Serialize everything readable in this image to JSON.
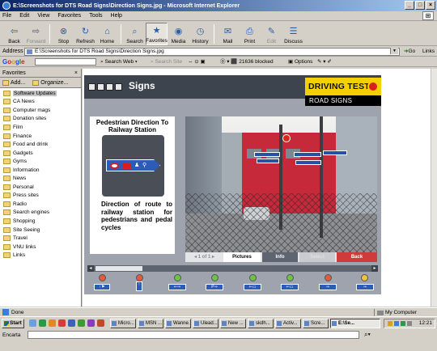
{
  "window": {
    "title": "E:\\Screenshots for DTS Road Signs\\Direction Signs.jpg - Microsoft Internet Explorer",
    "min": "_",
    "max": "□",
    "close": "×"
  },
  "menu": [
    "File",
    "Edit",
    "View",
    "Favorites",
    "Tools",
    "Help"
  ],
  "toolbar": [
    {
      "label": "Back",
      "icon": "back-arrow-icon",
      "glyph": "⇦",
      "disabled": false
    },
    {
      "label": "Forward",
      "icon": "forward-arrow-icon",
      "glyph": "⇨",
      "disabled": true
    },
    {
      "label": "Stop",
      "icon": "stop-icon",
      "glyph": "⊗",
      "disabled": false
    },
    {
      "label": "Refresh",
      "icon": "refresh-icon",
      "glyph": "↻",
      "disabled": false
    },
    {
      "label": "Home",
      "icon": "home-icon",
      "glyph": "⌂",
      "disabled": false
    },
    {
      "label": "Search",
      "icon": "search-icon",
      "glyph": "⌕",
      "disabled": false
    },
    {
      "label": "Favorites",
      "icon": "favorites-icon",
      "glyph": "★",
      "disabled": false,
      "active": true
    },
    {
      "label": "Media",
      "icon": "media-icon",
      "glyph": "◉",
      "disabled": false
    },
    {
      "label": "History",
      "icon": "history-icon",
      "glyph": "◷",
      "disabled": false
    },
    {
      "label": "Mail",
      "icon": "mail-icon",
      "glyph": "✉",
      "disabled": false
    },
    {
      "label": "Print",
      "icon": "print-icon",
      "glyph": "⎙",
      "disabled": false
    },
    {
      "label": "Edit",
      "icon": "edit-icon",
      "glyph": "✎",
      "disabled": true
    },
    {
      "label": "Discuss",
      "icon": "discuss-icon",
      "glyph": "☰",
      "disabled": false
    }
  ],
  "address": {
    "label": "Address",
    "value": "E:\\Screenshots for DTS Road Signs\\Direction Signs.jpg",
    "go": "Go",
    "links": "Links"
  },
  "google": {
    "logo": [
      "G",
      "o",
      "o",
      "g",
      "l",
      "e"
    ],
    "search_web": "Search Web",
    "search_site": "Search Site",
    "blocked": "21636 blocked",
    "options": "Options"
  },
  "sidebar": {
    "title": "Favorites",
    "close": "×",
    "add": "Add...",
    "organize": "Organize...",
    "items": [
      "Software Updates",
      "CA News",
      "Computer mags",
      "Donation sites",
      "Film",
      "Finance",
      "Food and drink",
      "Gadgets",
      "Gyms",
      "Information",
      "News",
      "Personal",
      "Press sites",
      "Radio",
      "Search engines",
      "Shopping",
      "Site Seeing",
      "Travel",
      "VNU links",
      "Links"
    ]
  },
  "app": {
    "title": "Signs",
    "brand_top": "DRIVING TEST",
    "brand_bottom": "ROAD SIGNS",
    "card_title": "Pedestrian Direction To Railway Station",
    "card_desc": "Direction of route to railway station for pedestrians and pedal cycles",
    "pager": "1 of 1",
    "tabs": {
      "pictures": "Pictures",
      "info": "Info",
      "blank": "Select",
      "back": "Back"
    }
  },
  "status": {
    "text": "Done",
    "zone": "My Computer"
  },
  "taskbar": {
    "start": "Start",
    "tasks": [
      "Micro...",
      "MSN ...",
      "Wanne...",
      "Ulead...",
      "New ...",
      "skdh...",
      "Activ...",
      "Scre...",
      "E:\\Se..."
    ],
    "clock": "12:21"
  },
  "encarta": {
    "label": "Encarta",
    "placeholder": ""
  },
  "colors": {
    "titlebar": "#0a246a",
    "app_dark": "#3e444d",
    "brand_yellow": "#f5d000",
    "sign_blue": "#2c5bb8",
    "back_red": "#cf3b3b"
  }
}
